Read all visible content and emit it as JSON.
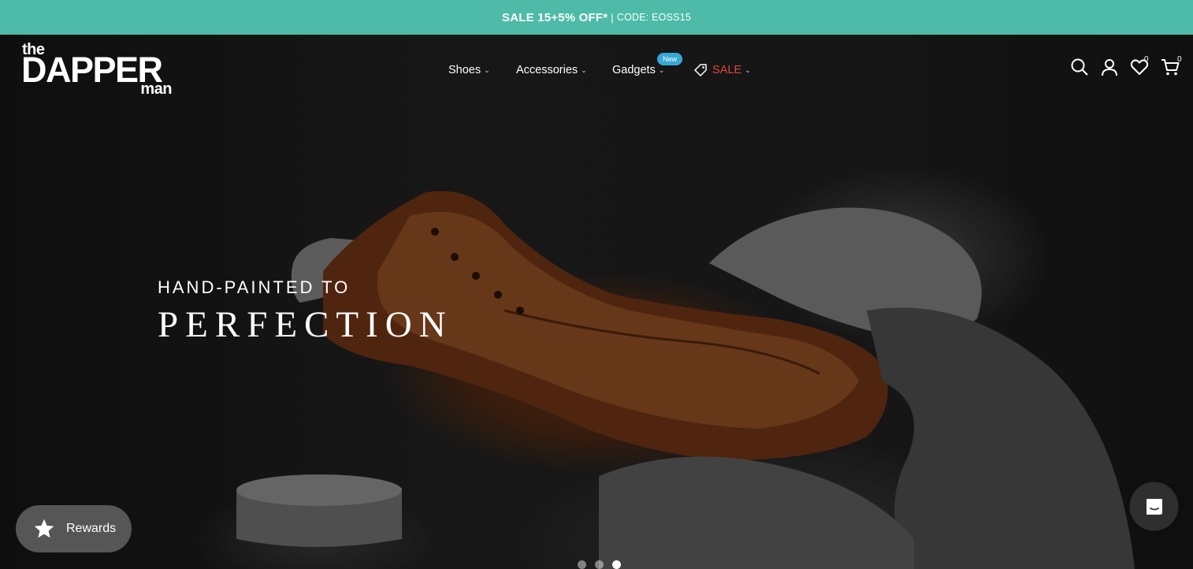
{
  "announcement": {
    "sale": "SALE 15+5% OFF*",
    "separator": "|",
    "code": "CODE: EOSS15"
  },
  "logo": {
    "the": "the",
    "dapper": "DAPPER",
    "man": "man"
  },
  "nav": {
    "items": [
      {
        "label": "Shoes"
      },
      {
        "label": "Accessories"
      },
      {
        "label": "Gadgets",
        "badge": "New"
      },
      {
        "label": "SALE"
      }
    ]
  },
  "header_icons": {
    "search": "search-icon",
    "account": "user-icon",
    "wishlist": "heart-icon",
    "wishlist_count": "0",
    "cart": "cart-icon",
    "cart_count": "0"
  },
  "hero": {
    "subtitle": "HAND-PAINTED TO",
    "title": "PERFECTION",
    "slides": 3,
    "active_slide": 3
  },
  "rewards": {
    "label": "Rewards",
    "icon": "star-icon"
  },
  "chat": {
    "icon": "chat-icon"
  },
  "colors": {
    "announcement_bg": "#4dbba7",
    "sale_red": "#e2463a",
    "badge_blue": "#37a8d6"
  }
}
